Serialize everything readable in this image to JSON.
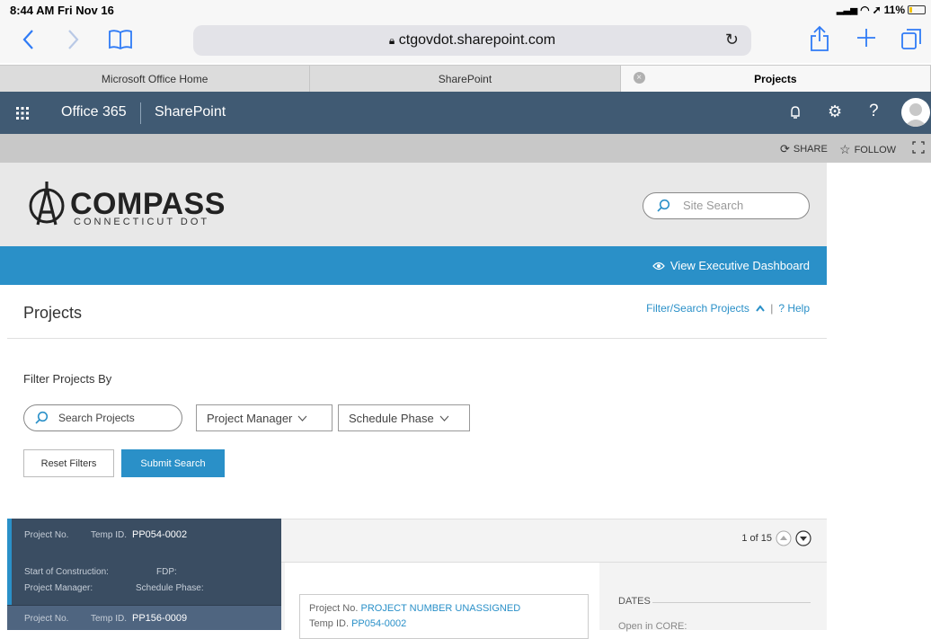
{
  "status_bar": {
    "time": "8:44 AM  Fri Nov 16",
    "battery": "11%"
  },
  "browser": {
    "url": "ctgovdot.sharepoint.com",
    "tabs": [
      {
        "label": "Microsoft Office Home",
        "active": false
      },
      {
        "label": "SharePoint",
        "active": false
      },
      {
        "label": "Projects",
        "active": true
      }
    ]
  },
  "suite_bar": {
    "office": "Office 365",
    "app": "SharePoint"
  },
  "command_bar": {
    "share": "SHARE",
    "follow": "FOLLOW"
  },
  "site": {
    "logo_name": "COMPASS",
    "logo_sub": "CONNECTICUT DOT",
    "search_placeholder": "Site Search"
  },
  "dashboard_link": "View Executive Dashboard",
  "page": {
    "title": "Projects",
    "filter_link": "Filter/Search Projects",
    "help_link": "? Help"
  },
  "filters": {
    "heading": "Filter Projects By",
    "search_placeholder": "Search Projects",
    "dropdowns": [
      "Project Manager",
      "Schedule Phase"
    ],
    "reset_label": "Reset Filters",
    "submit_label": "Submit Search"
  },
  "project_list": [
    {
      "project_no_label": "Project No.",
      "temp_id_label": "Temp ID.",
      "temp_id": "PP054-0002",
      "start_label": "Start of Construction:",
      "fdp_label": "FDP:",
      "pm_label": "Project Manager:",
      "phase_label": "Schedule Phase:"
    },
    {
      "project_no_label": "Project No.",
      "temp_id_label": "Temp ID.",
      "temp_id": "PP156-0009"
    }
  ],
  "detail": {
    "pager": "1 of 15",
    "project_no_label": "Project No.",
    "project_no_value": "PROJECT NUMBER UNASSIGNED",
    "temp_id_label": "Temp ID.",
    "temp_id_value": "PP054-0002",
    "dates_heading": "DATES",
    "open_in_core": "Open in CORE:"
  }
}
